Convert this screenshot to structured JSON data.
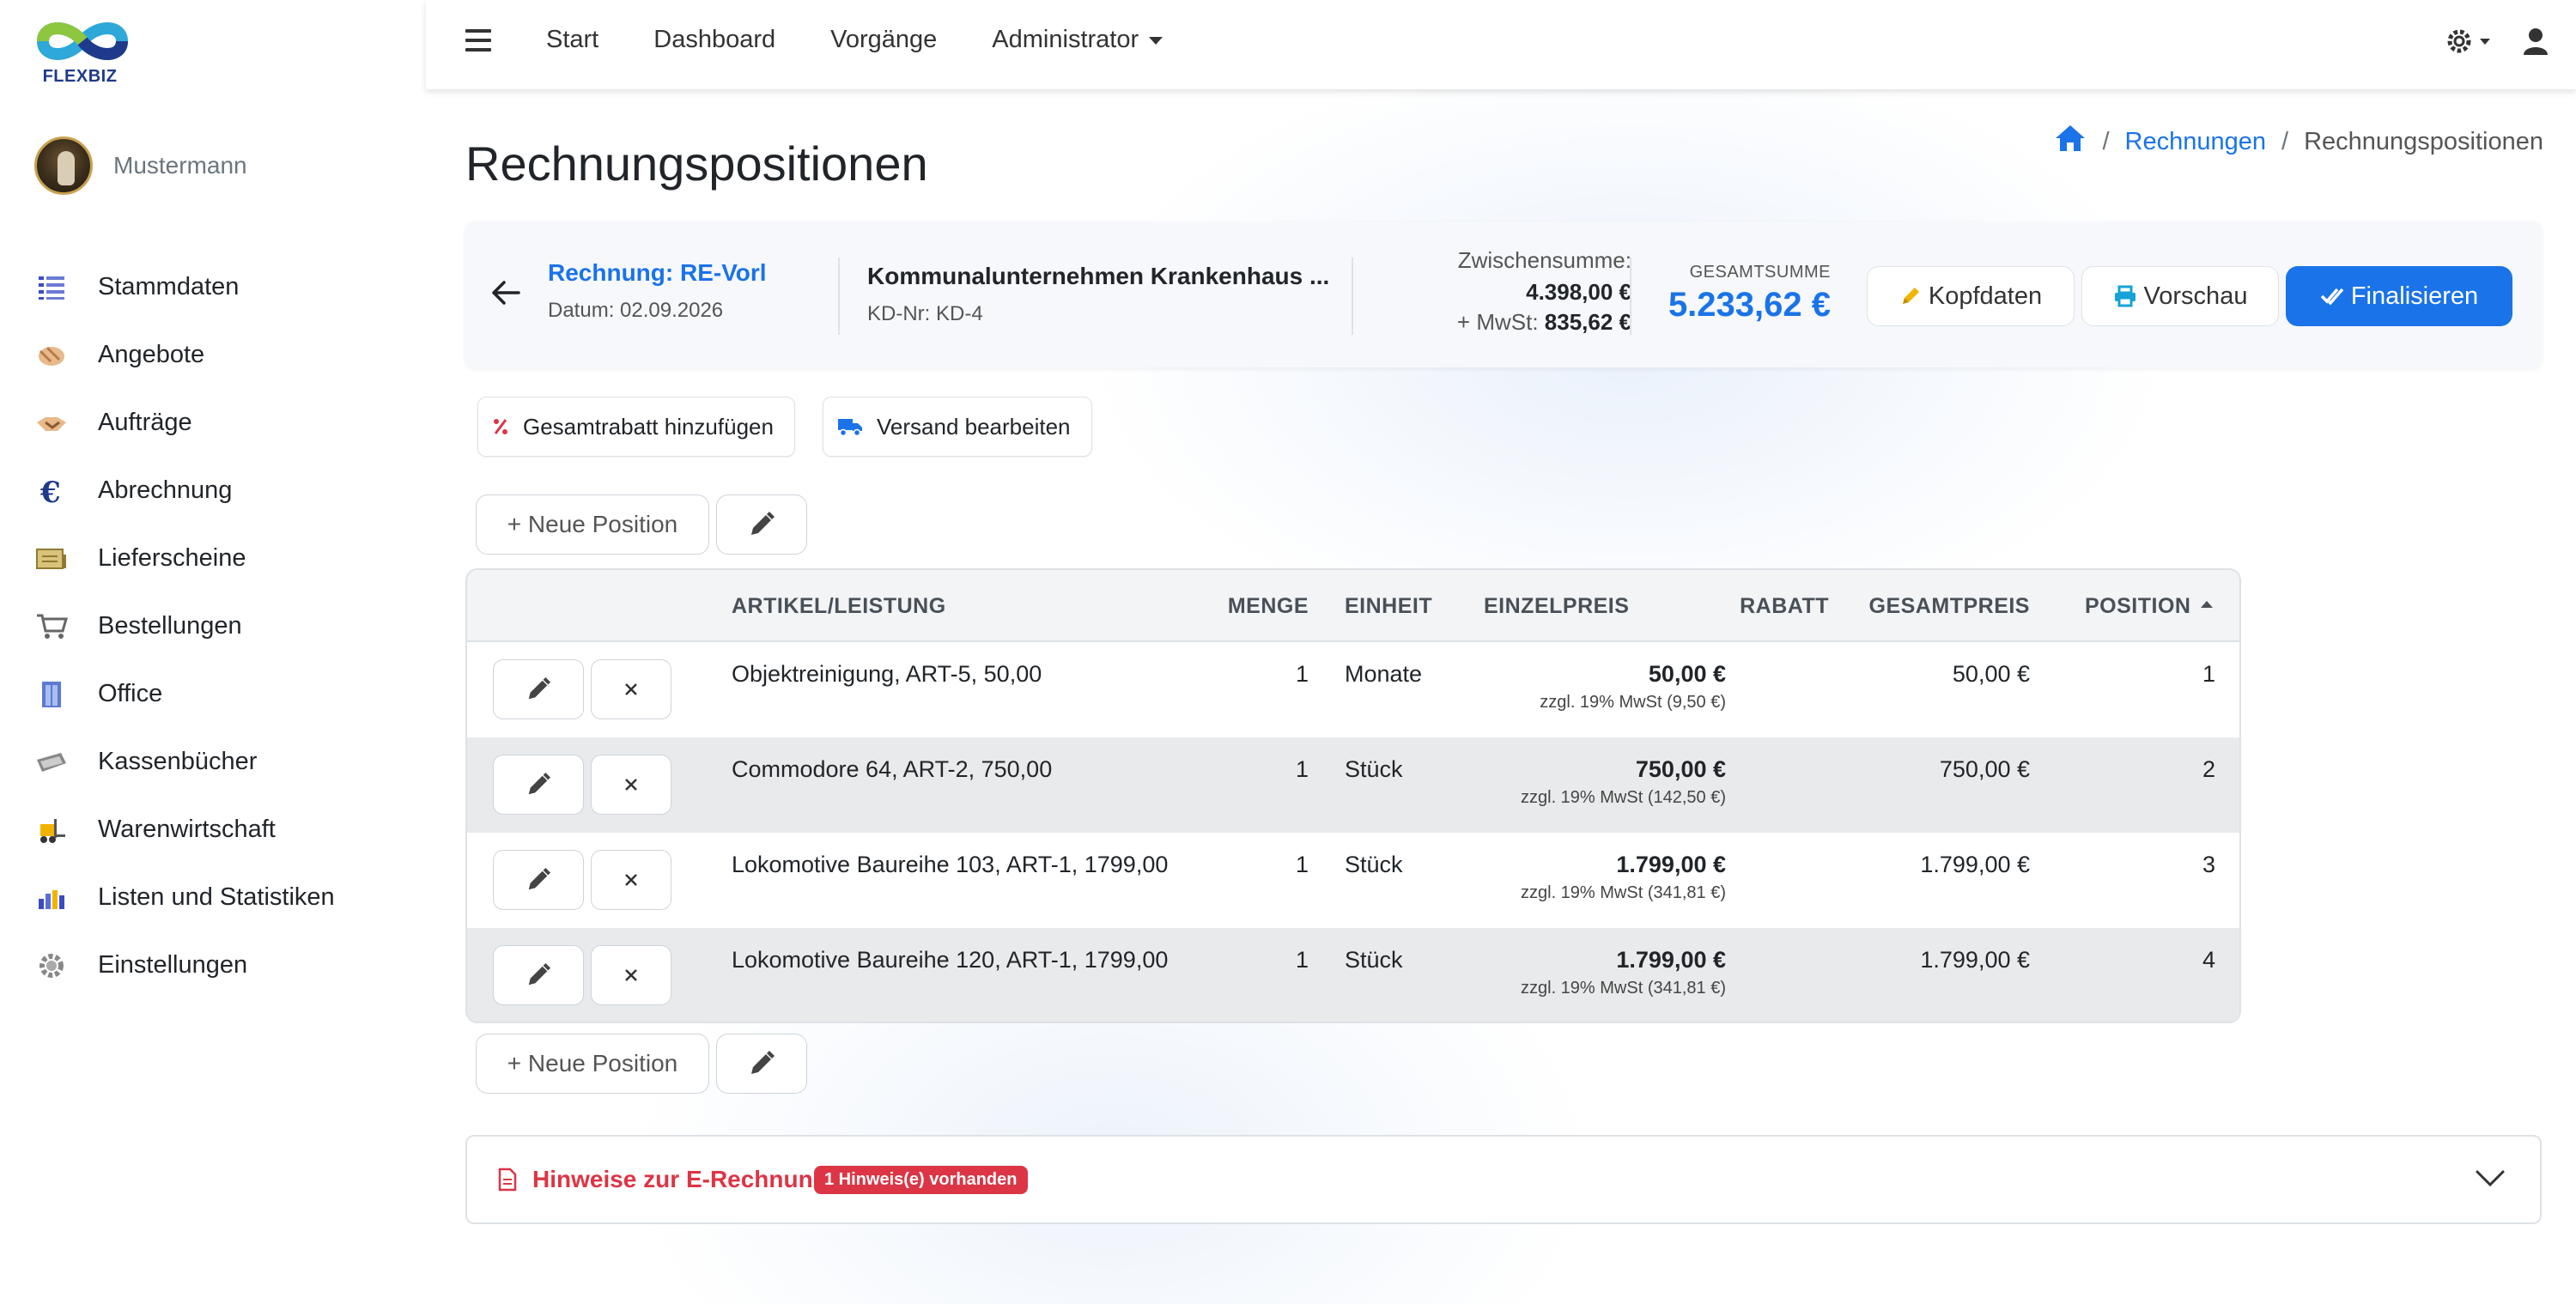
{
  "brand": {
    "name": "FLEXBIZ"
  },
  "user": {
    "name": "Mustermann"
  },
  "sidebar": {
    "items": [
      {
        "label": "Stammdaten",
        "icon": "list-icon"
      },
      {
        "label": "Angebote",
        "icon": "handshake-icon"
      },
      {
        "label": "Aufträge",
        "icon": "handshake-icon"
      },
      {
        "label": "Abrechnung",
        "icon": "euro-icon"
      },
      {
        "label": "Lieferscheine",
        "icon": "delivery-note-icon"
      },
      {
        "label": "Bestellungen",
        "icon": "cart-icon"
      },
      {
        "label": "Office",
        "icon": "office-icon"
      },
      {
        "label": "Kassenbücher",
        "icon": "cashbook-icon"
      },
      {
        "label": "Warenwirtschaft",
        "icon": "forklift-icon"
      },
      {
        "label": "Listen und Statistiken",
        "icon": "bar-chart-icon"
      },
      {
        "label": "Einstellungen",
        "icon": "gear-icon"
      }
    ]
  },
  "topnav": {
    "start": "Start",
    "dashboard": "Dashboard",
    "vorgaenge": "Vorgänge",
    "admin": "Administrator"
  },
  "page": {
    "title": "Rechnungspositionen"
  },
  "breadcrumb": {
    "parent": "Rechnungen",
    "current": "Rechnungspositionen"
  },
  "invoice": {
    "ref": "Rechnung: RE-Vorl",
    "date": "Datum: 02.09.2026",
    "customer": "Kommunalunternehmen Krankenhaus ...",
    "customer_no": "KD-Nr: KD-4",
    "subtotal_label": "Zwischensumme:",
    "subtotal": "4.398,00 €",
    "vat_label": "+ MwSt:",
    "vat": "835,62 €",
    "total_label": "GESAMTSUMME",
    "total": "5.233,62 €"
  },
  "buttons": {
    "kopfdaten": "Kopfdaten",
    "vorschau": "Vorschau",
    "finalisieren": "Finalisieren",
    "rabatt": "Gesamtrabatt hinzufügen",
    "versand": "Versand bearbeiten",
    "neue_position": "+ Neue Position"
  },
  "table": {
    "headers": {
      "artikel": "ARTIKEL/LEISTUNG",
      "menge": "MENGE",
      "einheit": "EINHEIT",
      "einzelpreis": "EINZELPREIS",
      "rabatt": "RABATT",
      "gesamtpreis": "GESAMTPREIS",
      "position": "POSITION"
    },
    "rows": [
      {
        "artikel": "Objektreinigung, ART-5, 50,00",
        "menge": "1",
        "einheit": "Monate",
        "einzelpreis": "50,00 €",
        "mwst": "zzgl. 19% MwSt (9,50 €)",
        "gesamtpreis": "50,00 €",
        "position": "1"
      },
      {
        "artikel": "Commodore 64, ART-2, 750,00",
        "menge": "1",
        "einheit": "Stück",
        "einzelpreis": "750,00 €",
        "mwst": "zzgl. 19% MwSt (142,50 €)",
        "gesamtpreis": "750,00 €",
        "position": "2"
      },
      {
        "artikel": "Lokomotive Baureihe 103, ART-1, 1799,00",
        "menge": "1",
        "einheit": "Stück",
        "einzelpreis": "1.799,00 €",
        "mwst": "zzgl. 19% MwSt (341,81 €)",
        "gesamtpreis": "1.799,00 €",
        "position": "3"
      },
      {
        "artikel": "Lokomotive Baureihe 120, ART-1, 1799,00",
        "menge": "1",
        "einheit": "Stück",
        "einzelpreis": "1.799,00 €",
        "mwst": "zzgl. 19% MwSt (341,81 €)",
        "gesamtpreis": "1.799,00 €",
        "position": "4"
      }
    ]
  },
  "hints": {
    "title": "Hinweise zur E-Rechnung",
    "badge": "1 Hinweis(e) vorhanden"
  },
  "colors": {
    "accent": "#1a73e8",
    "danger": "#dc3545"
  }
}
